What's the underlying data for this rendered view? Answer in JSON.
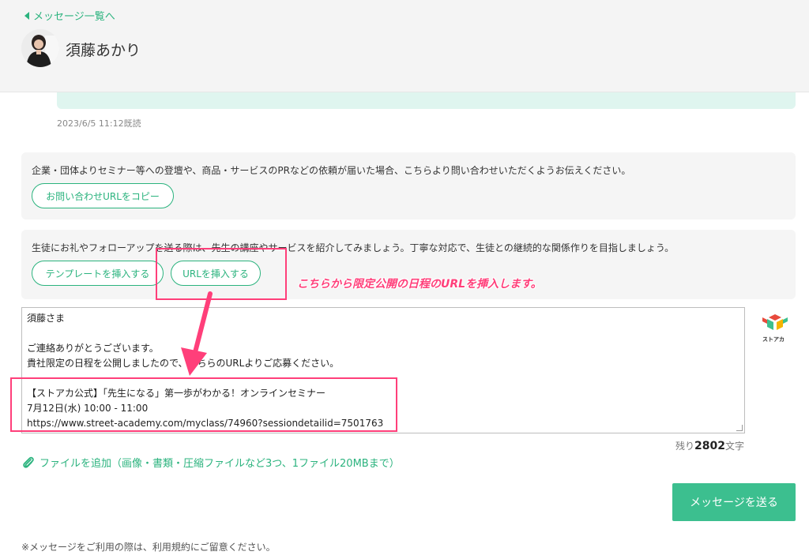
{
  "header": {
    "back_label": "メッセージ一覧へ",
    "user_name": "須藤あかり"
  },
  "previous_message": {
    "read_status": "2023/6/5 11:12既読"
  },
  "inquiry_box": {
    "text": "企業・団体よりセミナー等への登壇や、商品・サービスのPRなどの依頼が届いた場合、こちらより問い合わせいただくようお伝えください。",
    "button_label": "お問い合わせURLをコピー"
  },
  "followup_box": {
    "text": "生徒にお礼やフォローアップを送る際は、先生の講座やサービスを紹介してみましょう。丁寧な対応で、生徒との継続的な関係作りを目指しましょう。",
    "template_button_label": "テンプレートを挿入する",
    "url_button_label": "URLを挿入する"
  },
  "annotation": {
    "text": "こちらから限定公開の日程のURLを挿入します。",
    "color": "#ff3f7a"
  },
  "message": {
    "lines": [
      "須藤さま",
      "",
      "ご連絡ありがとうございます。",
      "貴社限定の日程を公開しましたので、こちらのURLよりご応募ください。",
      "",
      "【ストアカ公式】「先生になる」第一歩がわかる！オンラインセミナー",
      "7月12日(水) 10:00 - 11:00",
      "https://www.street-academy.com/myclass/74960?sessiondetailid=7501763"
    ]
  },
  "logo": {
    "text": "ストアカ"
  },
  "counter": {
    "prefix": "残り",
    "value": "2802",
    "suffix": "文字"
  },
  "attachment": {
    "label": "ファイルを追加（画像・書類・圧縮ファイルなど3つ、1ファイル20MBまで）"
  },
  "send_button": {
    "label": "メッセージを送る"
  },
  "footer": {
    "notice": "※メッセージをご利用の際は、利用規約にご留意ください。"
  },
  "colors": {
    "accent": "#2bb37e",
    "send_button": "#3cbf8f",
    "message_bubble": "#dff5ef"
  }
}
